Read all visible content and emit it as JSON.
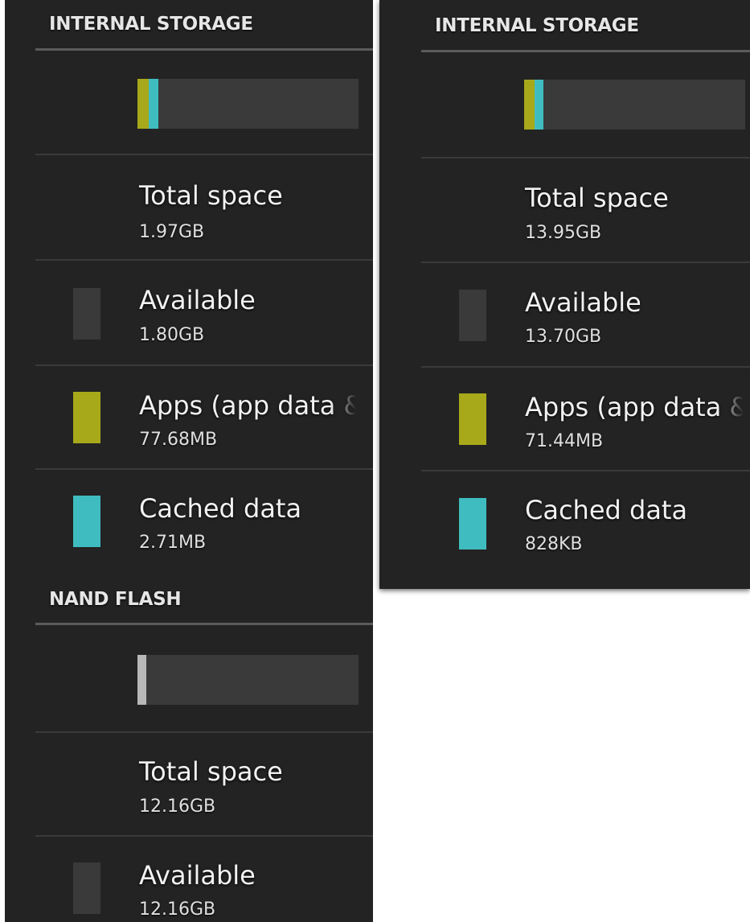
{
  "colors": {
    "background": "#232323",
    "available": "#3a3a3a",
    "apps": "#a7a91a",
    "cached": "#3fbcc0",
    "nand_used": "#b8b8b8"
  },
  "left": {
    "internal": {
      "header": "INTERNAL STORAGE",
      "usage": {
        "apps_fraction": 0.038,
        "cached_fraction": 0.0013
      },
      "total_label": "Total space",
      "total_value": "1.97GB",
      "available_label": "Available",
      "available_value": "1.80GB",
      "apps_label": "Apps (app data & media content)",
      "apps_value": "77.68MB",
      "cached_label": "Cached data",
      "cached_value": "2.71MB"
    },
    "nand": {
      "header": "NAND FLASH",
      "total_label": "Total space",
      "total_value": "12.16GB",
      "available_label": "Available",
      "available_value": "12.16GB"
    }
  },
  "right": {
    "internal": {
      "header": "INTERNAL STORAGE",
      "usage": {
        "apps_fraction": 0.005,
        "cached_fraction": 6e-05
      },
      "total_label": "Total space",
      "total_value": "13.95GB",
      "available_label": "Available",
      "available_value": "13.70GB",
      "apps_label": "Apps (app data & media content)",
      "apps_value": "71.44MB",
      "cached_label": "Cached data",
      "cached_value": "828KB"
    }
  }
}
